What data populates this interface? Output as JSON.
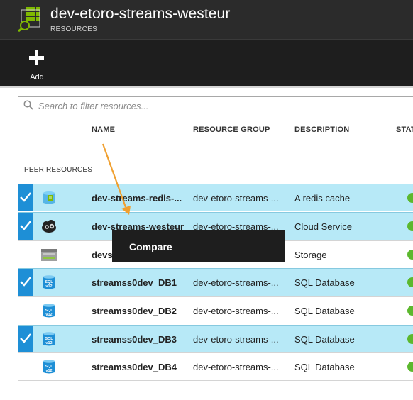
{
  "header": {
    "title": "dev-etoro-streams-westeur",
    "subtitle": "RESOURCES",
    "icon": "resource-group-icon"
  },
  "command_bar": {
    "add_label": "Add"
  },
  "search": {
    "placeholder": "Search to filter resources..."
  },
  "table": {
    "columns": [
      "NAME",
      "RESOURCE GROUP",
      "DESCRIPTION",
      "STAT"
    ],
    "section_label": "PEER RESOURCES",
    "rows": [
      {
        "name": "dev-streams-redis-...",
        "resource_group": "dev-etoro-streams-...",
        "description": "A redis cache",
        "selected": true,
        "icon": "redis-cache-icon"
      },
      {
        "name": "dev-streams-westeur",
        "resource_group": "dev-etoro-streams-...",
        "description": "Cloud Service",
        "selected": true,
        "icon": "cloud-service-icon"
      },
      {
        "name": "devst",
        "resource_group": "",
        "description": "Storage",
        "selected": false,
        "icon": "storage-icon"
      },
      {
        "name": "streamss0dev_DB1",
        "resource_group": "dev-etoro-streams-...",
        "description": "SQL Database",
        "selected": true,
        "icon": "sql-database-icon"
      },
      {
        "name": "streamss0dev_DB2",
        "resource_group": "dev-etoro-streams-...",
        "description": "SQL Database",
        "selected": false,
        "icon": "sql-database-icon"
      },
      {
        "name": "streamss0dev_DB3",
        "resource_group": "dev-etoro-streams-...",
        "description": "SQL Database",
        "selected": true,
        "icon": "sql-database-icon"
      },
      {
        "name": "streamss0dev_DB4",
        "resource_group": "dev-etoro-streams-...",
        "description": "SQL Database",
        "selected": false,
        "icon": "sql-database-icon"
      }
    ]
  },
  "context_menu": {
    "items": [
      "Compare"
    ]
  },
  "sql_icon_text": {
    "line1": "SQL",
    "line2": "v12"
  },
  "colors": {
    "header_bg": "#2b2b2b",
    "command_bar_bg": "#1e1e1e",
    "selected_row": "#b7e9f7",
    "checkbox_blue": "#1e8fd6",
    "status_green": "#5cb82e",
    "arrow_orange": "#f0a030"
  }
}
